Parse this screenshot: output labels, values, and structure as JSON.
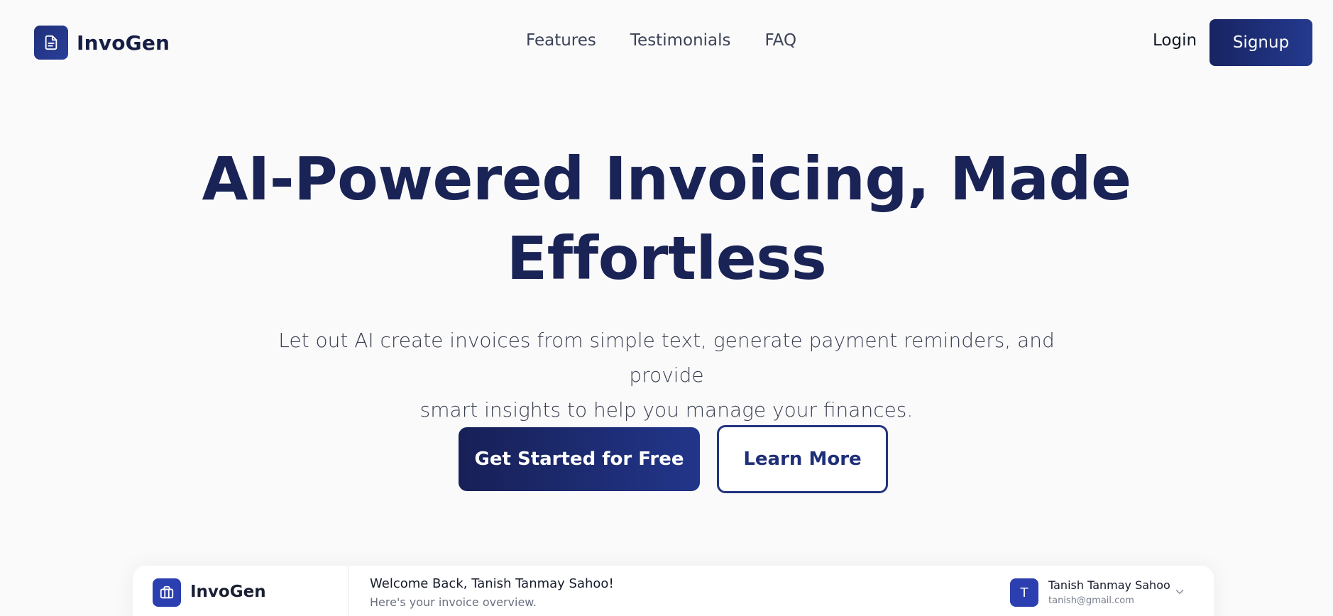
{
  "nav": {
    "brand": "InvoGen",
    "links": [
      "Features",
      "Testimonials",
      "FAQ"
    ],
    "login": "Login",
    "signup": "Signup"
  },
  "hero": {
    "title_line1": "AI-Powered Invoicing, Made",
    "title_line2": "Effortless",
    "subtitle_line1": "Let out AI create invoices from simple text, generate payment reminders, and provide",
    "subtitle_line2": "smart insights to help you manage your finances.",
    "primary_cta": "Get Started for Free",
    "secondary_cta": "Learn More"
  },
  "preview": {
    "brand": "InvoGen",
    "welcome": "Welcome Back, Tanish Tanmay Sahoo!",
    "overview": "Here's your invoice overview.",
    "user": {
      "initial": "T",
      "name": "Tanish Tanmay Sahoo",
      "email": "tanish@gmail.com"
    }
  },
  "colors": {
    "brand_dark": "#1a2356",
    "brand_accent": "#2b3fb0",
    "background": "#fafafa"
  },
  "icons": {
    "nav_logo": "document-icon",
    "preview_logo": "briefcase-icon",
    "preview_user_menu": "chevron-down-icon"
  }
}
